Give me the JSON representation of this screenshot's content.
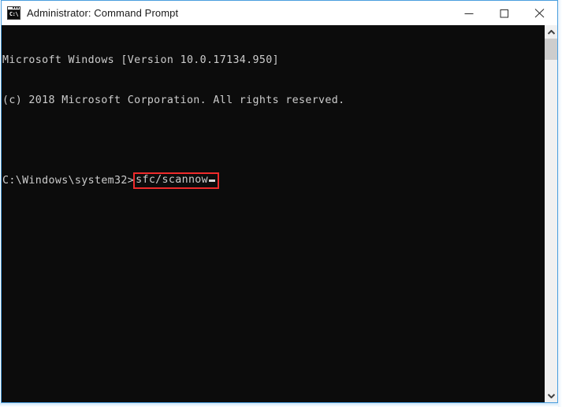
{
  "window": {
    "title": "Administrator: Command Prompt",
    "icon": "cmd-console-icon",
    "icon_label": "C:\\",
    "controls": {
      "minimize": "minimize-icon",
      "maximize": "maximize-icon",
      "close": "close-icon"
    },
    "border_color": "#4a9ede"
  },
  "console": {
    "background_color": "#0c0c0c",
    "text_color": "#cccccc",
    "lines": [
      "Microsoft Windows [Version 10.0.17134.950]",
      "(c) 2018 Microsoft Corporation. All rights reserved.",
      ""
    ],
    "prompt": {
      "path": "C:\\Windows\\system32>",
      "command": "sfc/scannow",
      "cursor": "_",
      "highlight_color": "#ee2b2b"
    }
  },
  "scrollbar": {
    "up_arrow": "chevron-up-icon",
    "down_arrow": "chevron-down-icon",
    "track_color": "#f0f0f0",
    "thumb_color": "#cdcdcd"
  }
}
